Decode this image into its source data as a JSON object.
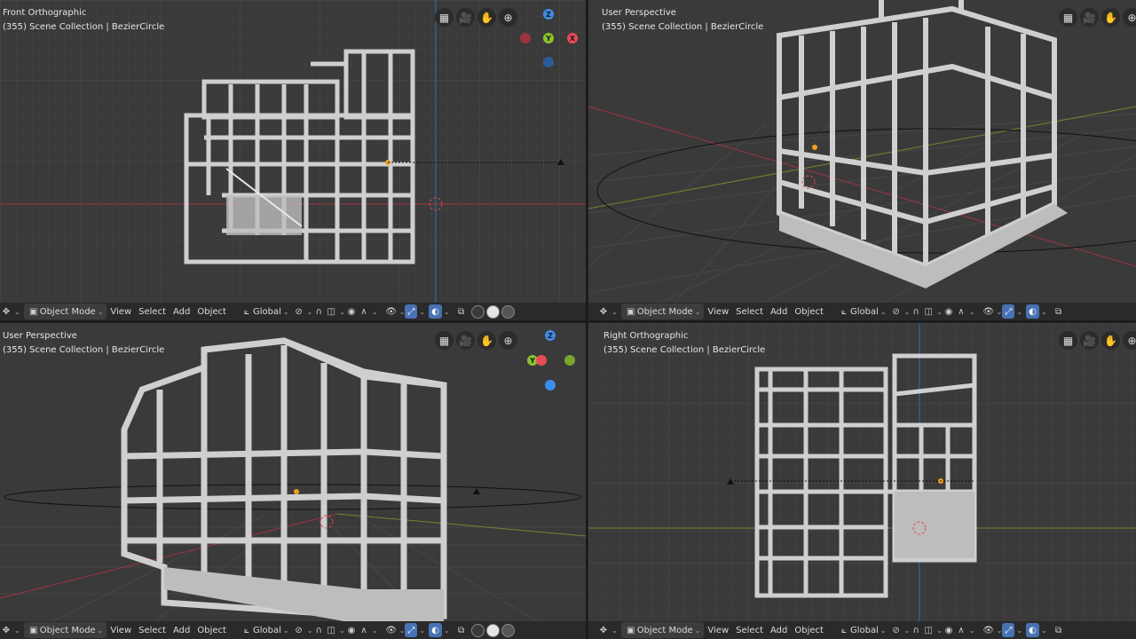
{
  "viewports": [
    {
      "title": "Front Orthographic",
      "subtitle": "(355) Scene Collection | BezierCircle"
    },
    {
      "title": "User Perspective",
      "subtitle": "(355) Scene Collection | BezierCircle"
    },
    {
      "title": "User Perspective",
      "subtitle": "(355) Scene Collection | BezierCircle"
    },
    {
      "title": "Right Orthographic",
      "subtitle": "(355) Scene Collection | BezierCircle"
    }
  ],
  "header": {
    "mode": "Object Mode",
    "menu_view": "View",
    "menu_select": "Select",
    "menu_add": "Add",
    "menu_object": "Object",
    "transform_orientation": "Global"
  },
  "gizmo": {
    "axis_x": "X",
    "axis_y": "Y",
    "axis_z": "Z",
    "color_x": "#e84b56",
    "color_y": "#8ac22c",
    "color_z": "#3d8ee8"
  },
  "icons": [
    "grid-icon",
    "camera-icon",
    "hand-pan-icon",
    "zoom-icon",
    "editor-type-icon",
    "mode-icon",
    "link-icon",
    "snap-icon",
    "proportional-icon",
    "visibility-icon",
    "gizmo-icon",
    "overlay-icon",
    "xray-icon",
    "wireframe-shading-icon",
    "solid-shading-icon",
    "material-shading-icon",
    "rendered-shading-icon"
  ]
}
